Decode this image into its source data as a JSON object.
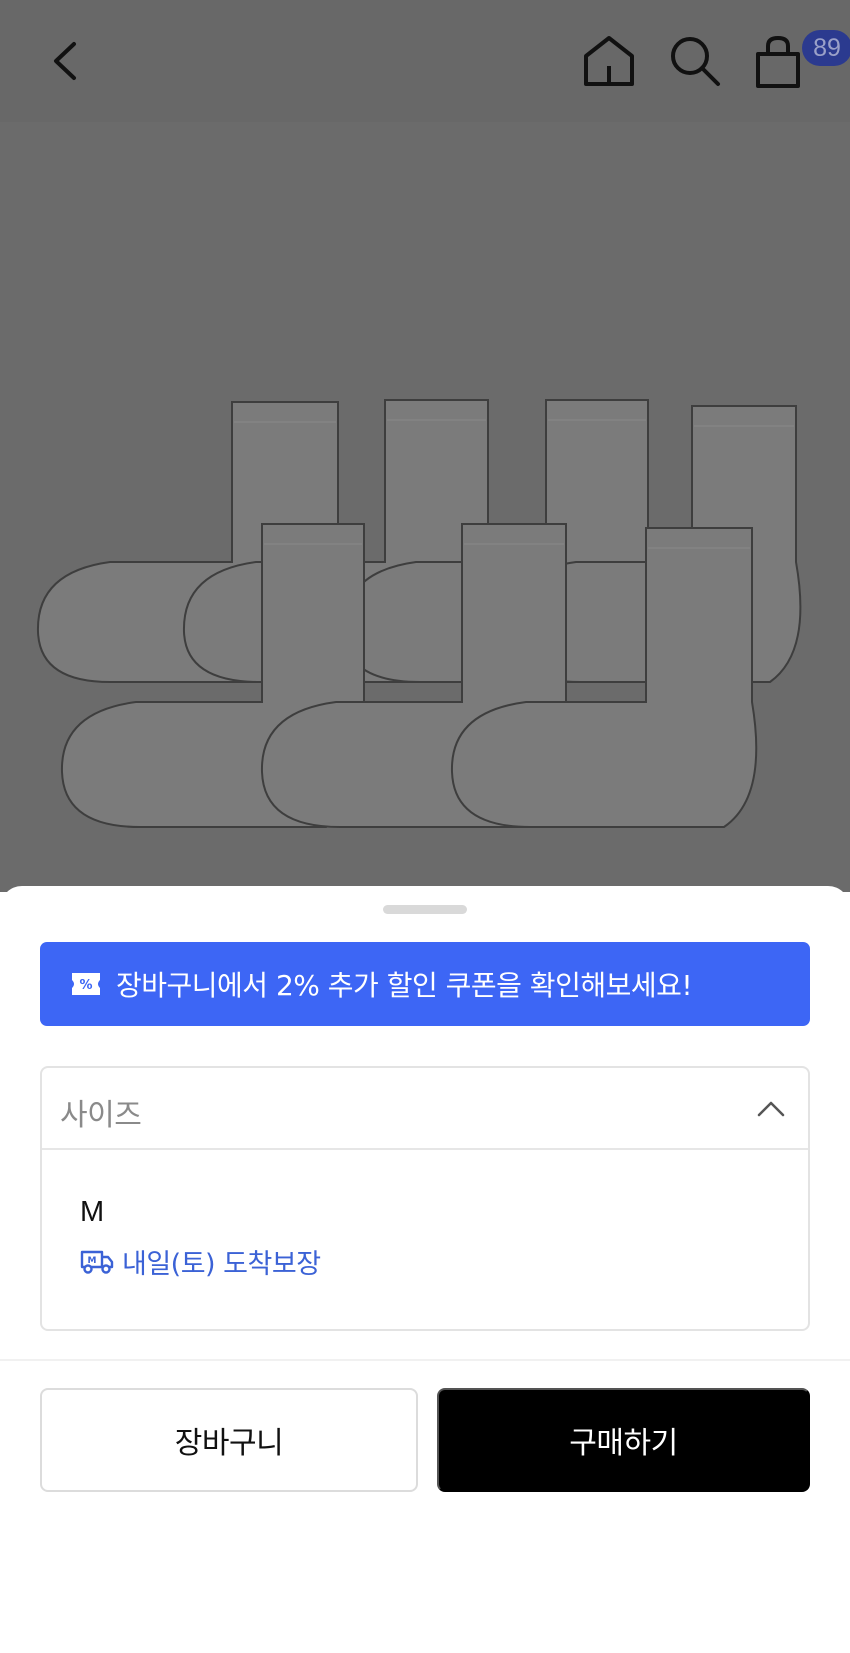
{
  "header": {
    "cart_badge": "89",
    "icons": [
      "back-icon",
      "home-icon",
      "search-icon",
      "shopping-bag-icon"
    ]
  },
  "product_image": {
    "subject": "socks"
  },
  "sheet": {
    "coupon_banner": {
      "icon": "coupon-icon",
      "text": "장바구니에서 2% 추가 할인 쿠폰을 확인해보세요!"
    },
    "size_select": {
      "label": "사이즈",
      "expanded": true,
      "options": [
        {
          "name": "M",
          "delivery": "내일(토) 도착보장",
          "delivery_icon": "truck-icon"
        }
      ]
    },
    "buttons": {
      "cart_label": "장바구니",
      "buy_label": "구매하기"
    }
  },
  "colors": {
    "overlay": "#686868",
    "banner": "#3d66f5",
    "delivery_text": "#3b62d6",
    "badge": "#2b3a8f",
    "buy_button": "#000000"
  }
}
